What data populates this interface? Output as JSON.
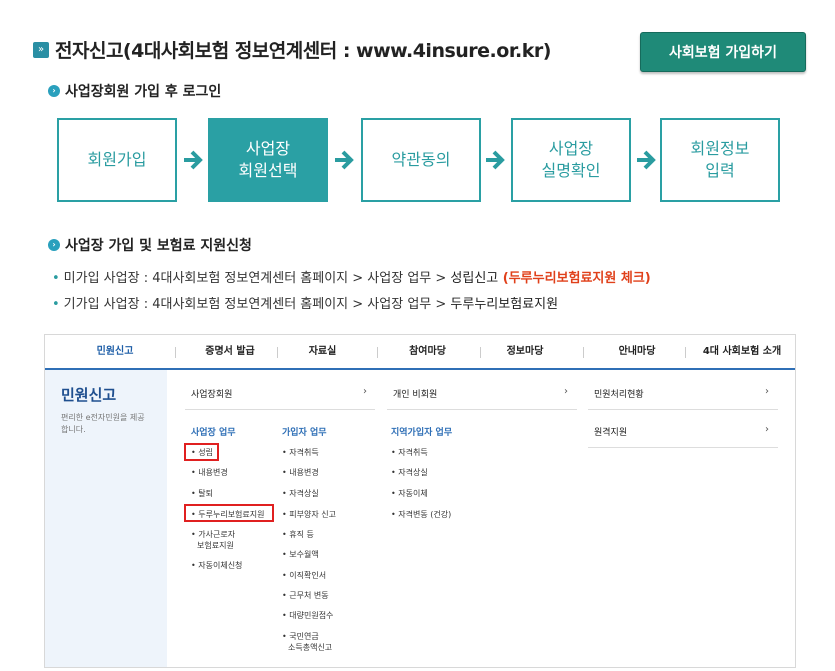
{
  "header": {
    "icon": "double-chevron-icon",
    "title": "전자신고(4대사회보험 정보연계센터 : www.4insure.or.kr)",
    "join_button": "사회보험 가입하기"
  },
  "section1": {
    "title": "사업장회원 가입 후 로그인",
    "steps": [
      {
        "lines": [
          "회원가입"
        ],
        "active": false
      },
      {
        "lines": [
          "사업장",
          "회원선택"
        ],
        "active": true
      },
      {
        "lines": [
          "약관동의"
        ],
        "active": false
      },
      {
        "lines": [
          "사업장",
          "실명확인"
        ],
        "active": false
      },
      {
        "lines": [
          "회원정보",
          "입력"
        ],
        "active": false
      }
    ]
  },
  "section2": {
    "title": "사업장 가입 및 보험료 지원신청",
    "lines": [
      {
        "prefix": "미가입 사업장 : 4대사회보험 정보연계센터 홈페이지 > 사업장 업무 > ",
        "strong": "성립신고",
        "red": " (두루누리보험료지원 체크)"
      },
      {
        "prefix": "기가입 사업장 : 4대사회보험 정보연계센터 홈페이지 > 사업장 업무 > ",
        "strong": "두루누리보험료지원",
        "red": ""
      }
    ]
  },
  "site": {
    "gnb": [
      "민원신고",
      "증명서 발급",
      "자료실",
      "참여마당",
      "정보마당",
      "안내마당",
      "4대 사회보험 소개"
    ],
    "lnb_title": "민원신고",
    "lnb_desc": "편리한 e전자민원을 제공합니다.",
    "top_menu": [
      "사업장회원",
      "개인 비회원",
      "민원처리현황",
      "원격지원"
    ],
    "chevron": "›",
    "col1": {
      "header": "사업장 업무",
      "items": [
        "• 성립",
        "• 내용변경",
        "• 탈퇴",
        "• 두루누리보험료지원",
        "• 가사근로자",
        "보험료지원",
        "• 자동이체신청"
      ]
    },
    "col2": {
      "header": "가입자 업무",
      "items": [
        "• 자격취득",
        "• 내용변경",
        "• 자격상실",
        "• 피부양자 신고",
        "• 휴직 등",
        "• 보수월액",
        "• 이직확인서",
        "• 근무처 변동",
        "• 대량민원접수",
        "• 국민연금",
        "소득총액신고"
      ]
    },
    "col3": {
      "header": "지역가입자 업무",
      "items": [
        "• 자격취득",
        "• 자격상실",
        "• 자동이체",
        "• 자격변동 (건강)"
      ]
    }
  }
}
